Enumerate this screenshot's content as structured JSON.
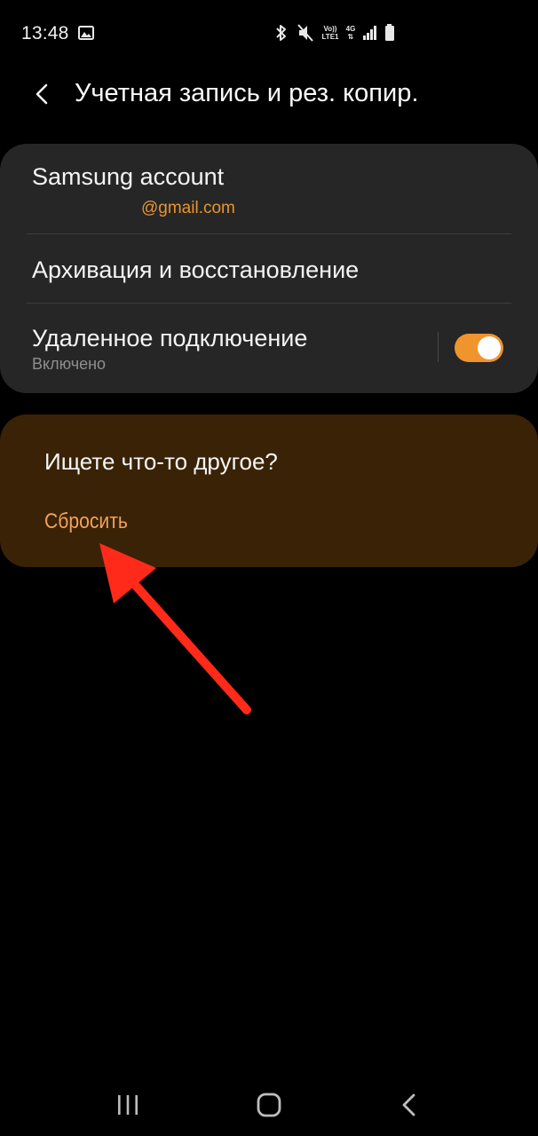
{
  "status_bar": {
    "time": "13:48",
    "gallery_icon": "image-icon",
    "volte_top": "Vo))",
    "volte_bottom": "LTE1",
    "network_type": "4G",
    "icons": [
      "bluetooth-icon",
      "mute-icon",
      "signal-icon",
      "battery-icon"
    ]
  },
  "header": {
    "title": "Учетная запись и рез. копир.",
    "back_icon": "chevron-left-icon"
  },
  "settings": {
    "samsung_account": {
      "title": "Samsung account",
      "email": "@gmail.com"
    },
    "backup": {
      "title": "Архивация и восстановление"
    },
    "remote_connection": {
      "title": "Удаленное подключение",
      "status": "Включено",
      "enabled": true
    }
  },
  "suggestion": {
    "title": "Ищете что-то другое?",
    "reset_label": "Сбросить"
  },
  "colors": {
    "accent": "#f0942e",
    "link": "#f1a25a",
    "card": "#262626",
    "suggestion_card": "#3a2206",
    "arrow": "#ff2a1a"
  },
  "nav_bar": {
    "recent_icon": "recent-apps-icon",
    "home_icon": "home-icon",
    "back_icon": "back-icon"
  }
}
